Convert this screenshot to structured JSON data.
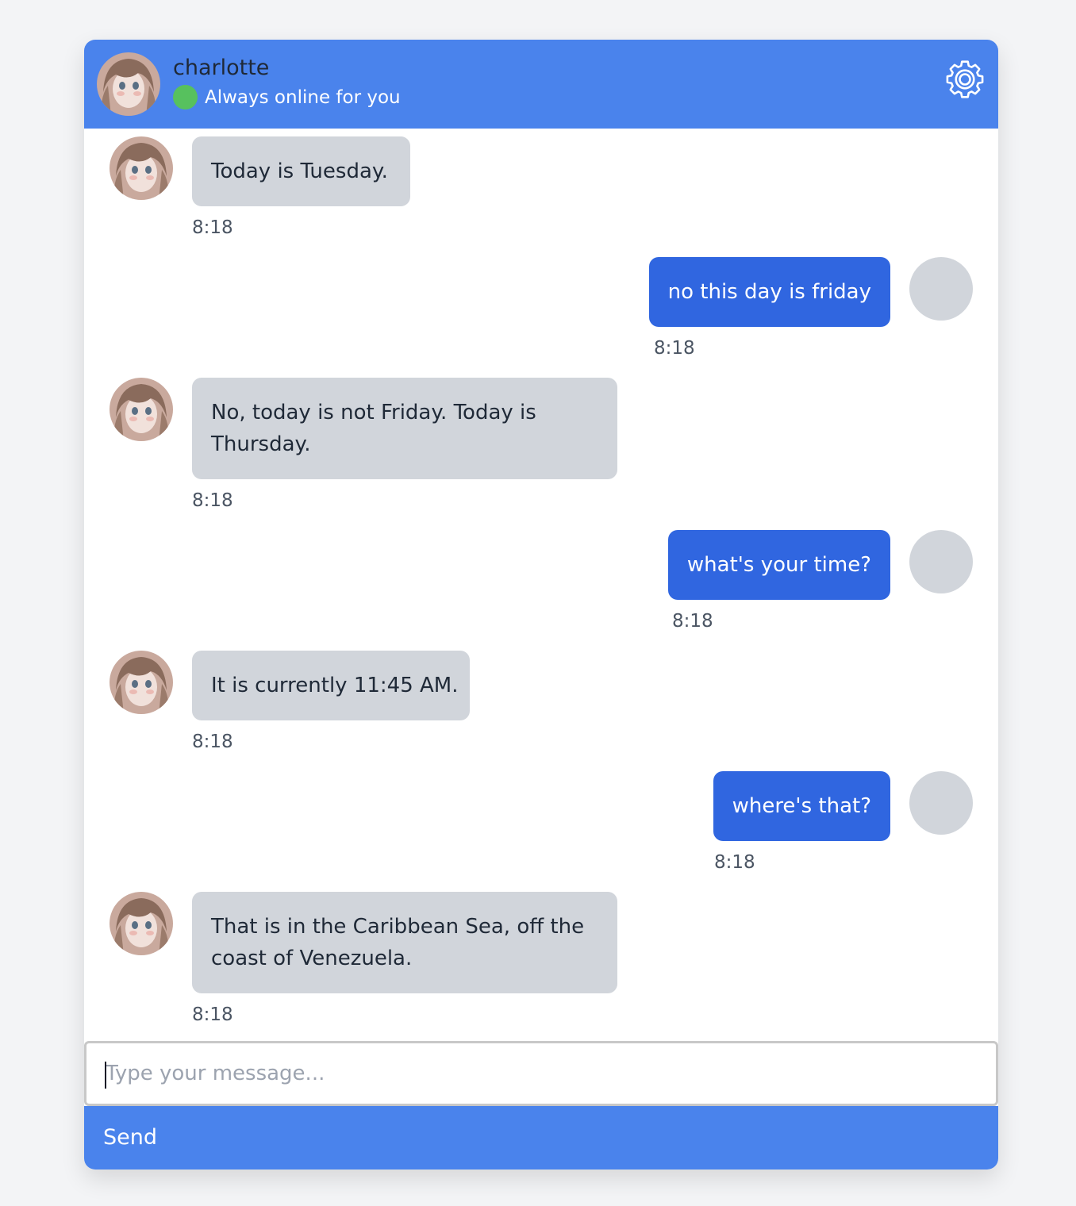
{
  "header": {
    "bot_name": "charlotte",
    "status_text": "Always online for you",
    "status_color": "#57c15e",
    "settings_icon": "gear-icon",
    "accent_color": "#4a83ec"
  },
  "messages": [
    {
      "sender": "bot",
      "text": "Today is Tuesday.",
      "time": "8:18"
    },
    {
      "sender": "user",
      "text": "no this day is friday",
      "time": "8:18"
    },
    {
      "sender": "bot",
      "text": "No, today is not Friday. Today is Thursday.",
      "time": "8:18"
    },
    {
      "sender": "user",
      "text": "what's your time?",
      "time": "8:18"
    },
    {
      "sender": "bot",
      "text": "It is currently 11:45 AM.",
      "time": "8:18"
    },
    {
      "sender": "user",
      "text": "where's that?",
      "time": "8:18"
    },
    {
      "sender": "bot",
      "text": "That is in the Caribbean Sea, off the coast of Venezuela.",
      "time": "8:18"
    }
  ],
  "composer": {
    "placeholder": "Type your message...",
    "value": "",
    "send_label": "Send"
  }
}
